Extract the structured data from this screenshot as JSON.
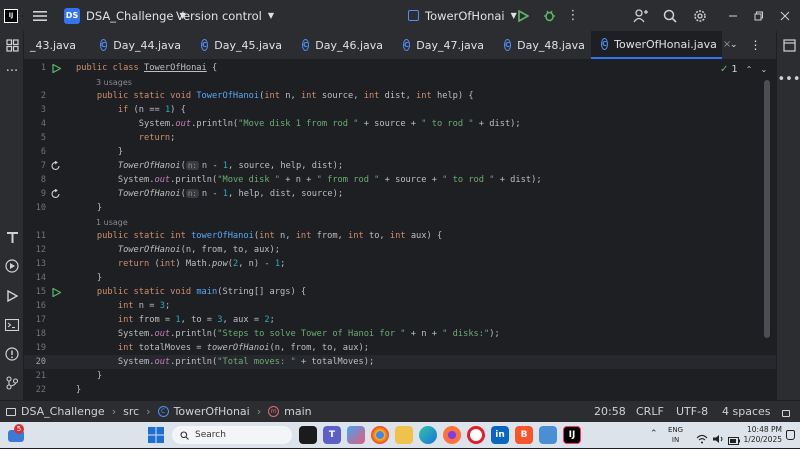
{
  "titlebar": {
    "project_badge": "DS",
    "project_name": "DSA_Challenge",
    "vcs_label": "Version control",
    "run_config": "TowerOfHonai"
  },
  "tabs": [
    {
      "label": "_43.java",
      "active": false
    },
    {
      "label": "Day_44.java",
      "active": false
    },
    {
      "label": "Day_45.java",
      "active": false
    },
    {
      "label": "Day_46.java",
      "active": false
    },
    {
      "label": "Day_47.java",
      "active": false
    },
    {
      "label": "Day_48.java",
      "active": false
    },
    {
      "label": "TowerOfHonai.java",
      "active": true
    }
  ],
  "editor": {
    "inspection_count": "1",
    "usage_hints": {
      "line1": "3 usages",
      "line10": "1 usage"
    }
  },
  "statusbar": {
    "breadcrumb": [
      "DSA_Challenge",
      "src",
      "TowerOfHonai",
      "main"
    ],
    "cursor_position": "20:58",
    "line_separator": "CRLF",
    "encoding": "UTF-8",
    "indent": "4 spaces"
  },
  "taskbar": {
    "search_placeholder": "Search",
    "notification_count": "5",
    "language_top": "ENG",
    "language_bottom": "IN",
    "time": "10:48 PM",
    "date": "1/20/2025"
  },
  "colors": {
    "accent": "#3574f0",
    "keyword": "#cf8e6d",
    "string": "#6aab73",
    "function": "#56a8f5",
    "number": "#2aacb8",
    "static": "#c77dbb"
  }
}
